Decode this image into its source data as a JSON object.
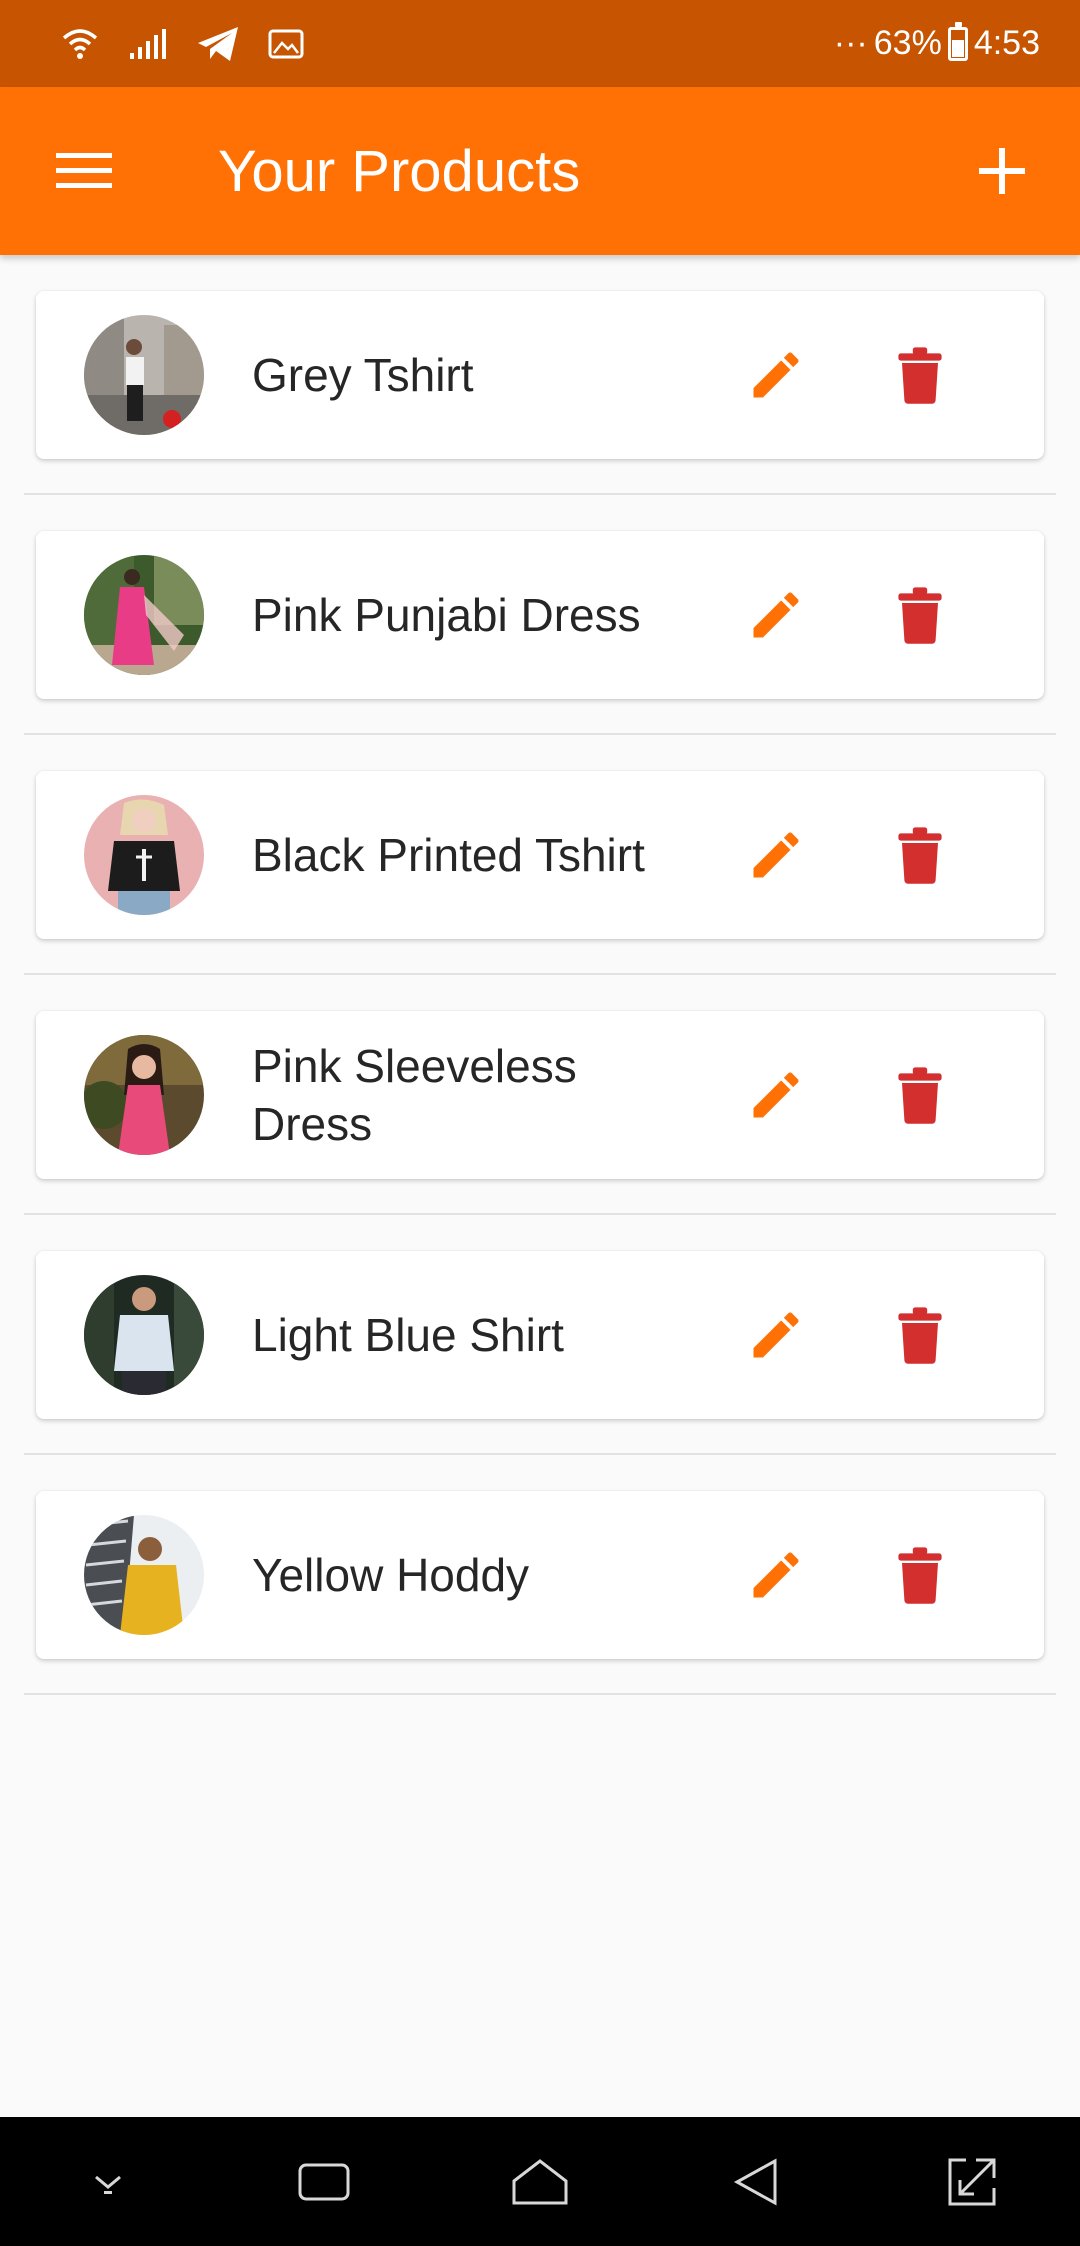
{
  "status_bar": {
    "battery": "63%",
    "time": "4:53",
    "dots": "···"
  },
  "app_bar": {
    "title": "Your Products"
  },
  "colors": {
    "status_bar": "#c65400",
    "app_bar": "#ff7105",
    "edit_icon": "#ff7105",
    "delete_icon": "#d32f2f"
  },
  "products": [
    {
      "name": "Grey Tshirt"
    },
    {
      "name": "Pink Punjabi Dress"
    },
    {
      "name": "Black Printed Tshirt"
    },
    {
      "name": "Pink Sleeveless Dress"
    },
    {
      "name": "Light Blue Shirt"
    },
    {
      "name": "Yellow Hoddy"
    }
  ]
}
